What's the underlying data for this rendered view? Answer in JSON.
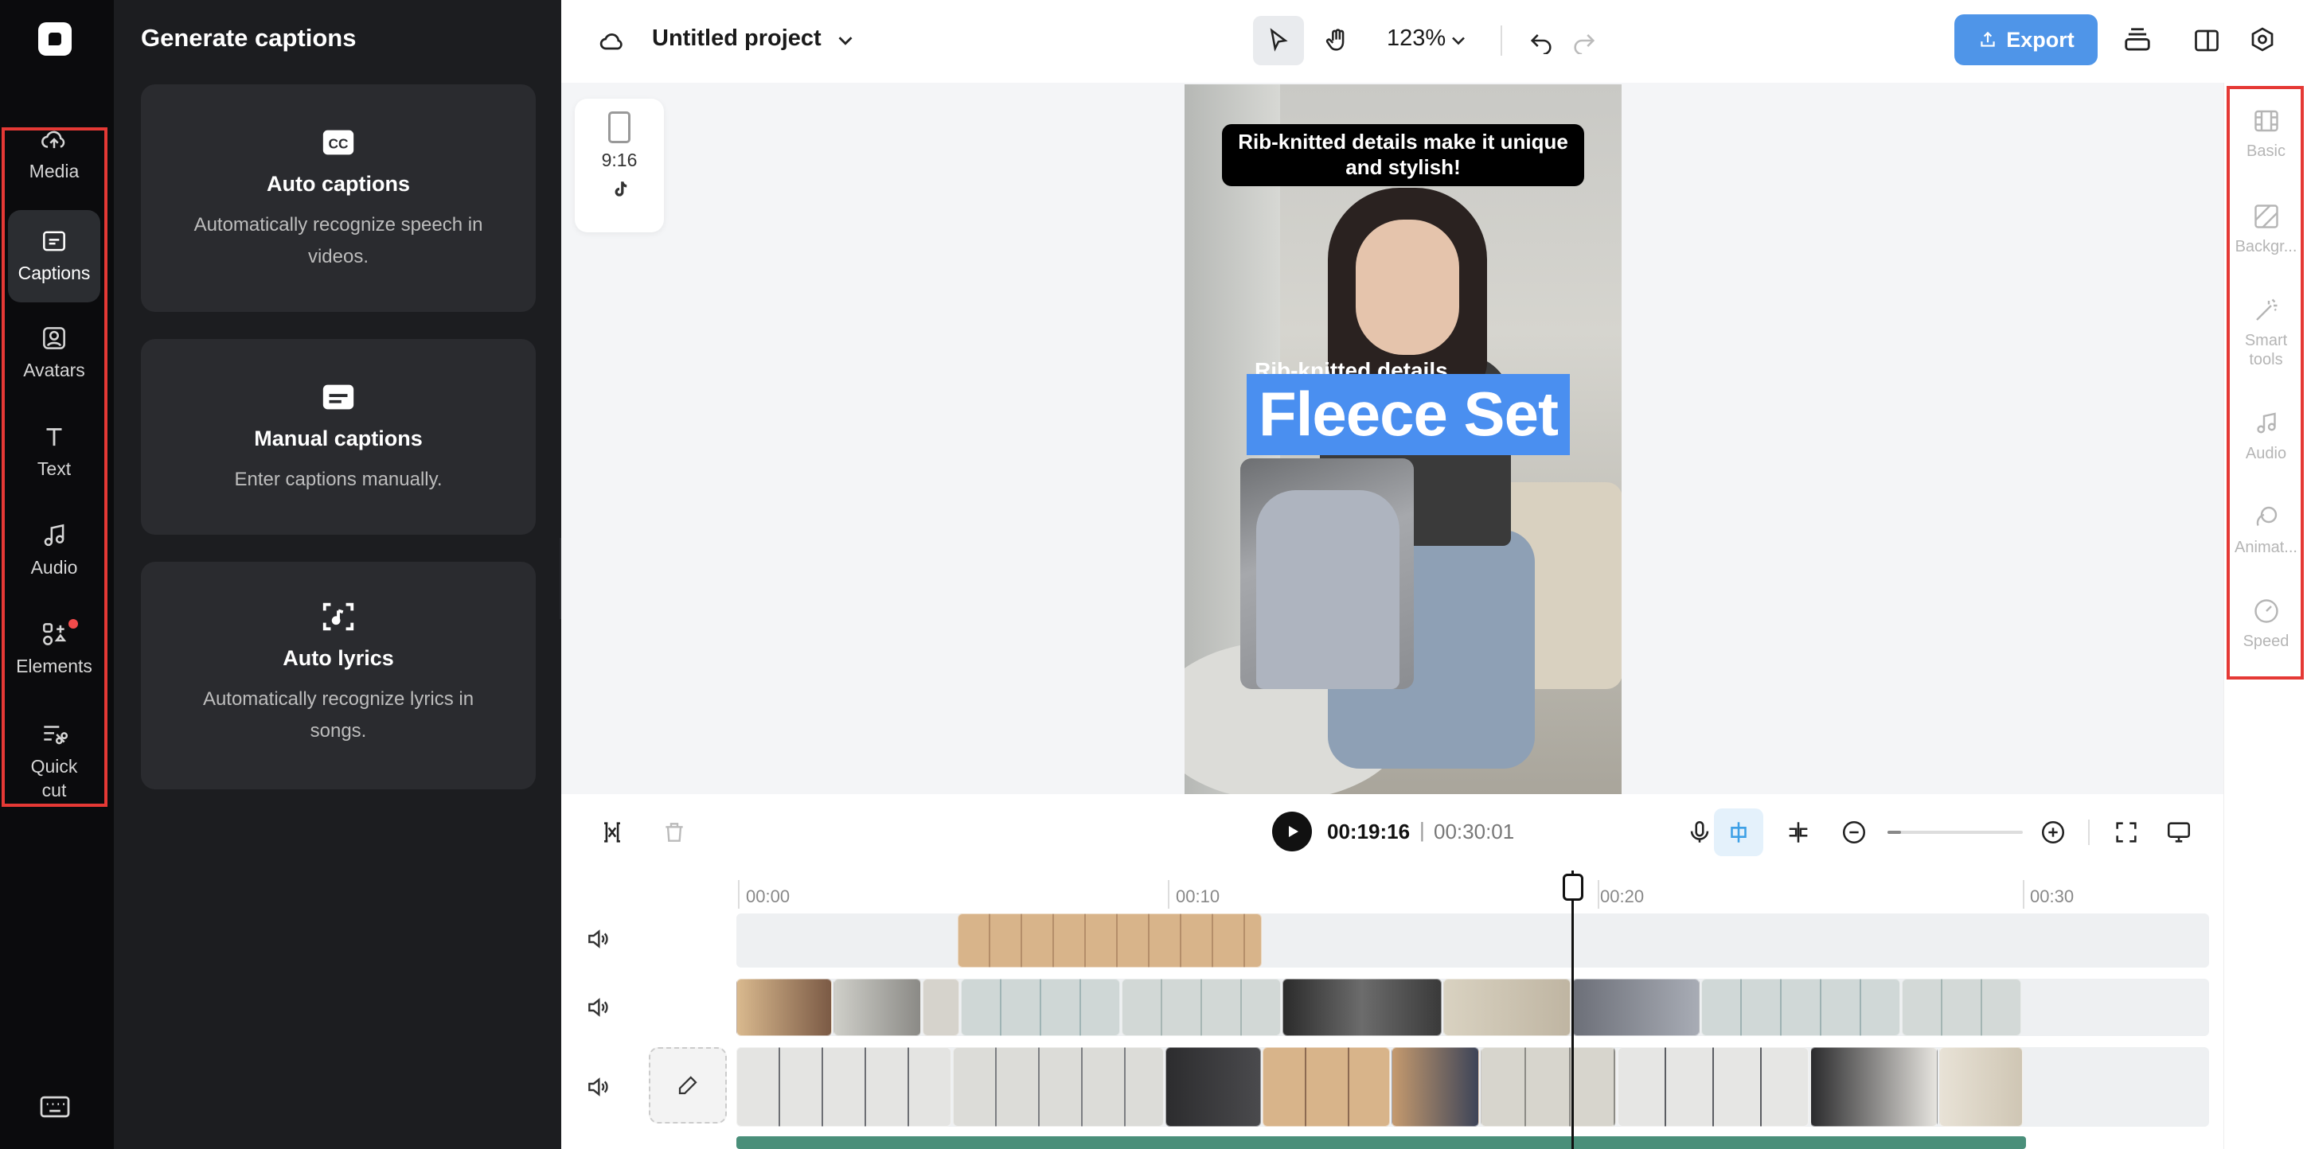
{
  "rail": {
    "items": [
      {
        "label": "Media",
        "icon": "cloud-upload-icon"
      },
      {
        "label": "Captions",
        "icon": "captions-icon",
        "active": true
      },
      {
        "label": "Avatars",
        "icon": "avatar-icon"
      },
      {
        "label": "Text",
        "icon": "text-icon"
      },
      {
        "label": "Audio",
        "icon": "music-note-icon"
      },
      {
        "label": "Elements",
        "icon": "elements-icon",
        "badge": true
      },
      {
        "label": "Quick cut",
        "label_lines": [
          "Quick",
          "cut"
        ],
        "icon": "quick-cut-icon"
      }
    ],
    "keyboard_icon": "keyboard-icon"
  },
  "panel": {
    "title": "Generate captions",
    "cards": [
      {
        "title": "Auto captions",
        "desc": "Automatically recognize speech in videos.",
        "icon": "cc-icon"
      },
      {
        "title": "Manual captions",
        "desc": "Enter captions manually.",
        "icon": "subtitle-icon"
      },
      {
        "title": "Auto lyrics",
        "desc": "Automatically recognize lyrics in songs.",
        "icon": "lyrics-scan-icon"
      }
    ]
  },
  "topbar": {
    "project_title": "Untitled project",
    "zoom": "123%",
    "export_label": "Export"
  },
  "canvas": {
    "aspect_ratio": "9:16",
    "caption_top": "Rib-knitted details make it unique and stylish!",
    "caption_sub": "Rib-knitted details",
    "caption_main": "Fleece Set"
  },
  "playback": {
    "current_time": "00:19:16",
    "separator": "|",
    "total_time": "00:30:01",
    "zoom_slider_level": 0.1
  },
  "timeline": {
    "ticks": [
      "00:00",
      "00:10",
      "00:20",
      "00:30"
    ]
  },
  "right_rail": {
    "items": [
      {
        "label": "Basic",
        "icon": "film-icon"
      },
      {
        "label": "Backgr...",
        "icon": "background-icon"
      },
      {
        "label": "Smart tools",
        "label_lines": [
          "Smart",
          "tools"
        ],
        "icon": "magic-wand-icon"
      },
      {
        "label": "Audio",
        "icon": "music-note-icon"
      },
      {
        "label": "Animat...",
        "icon": "animation-icon"
      },
      {
        "label": "Speed",
        "icon": "speed-icon"
      }
    ]
  },
  "colors": {
    "accent_blue": "#4f95e8",
    "caption_blue": "#4a8ff0",
    "highlight_red": "#e53935",
    "panel_dark": "#1c1d20"
  }
}
